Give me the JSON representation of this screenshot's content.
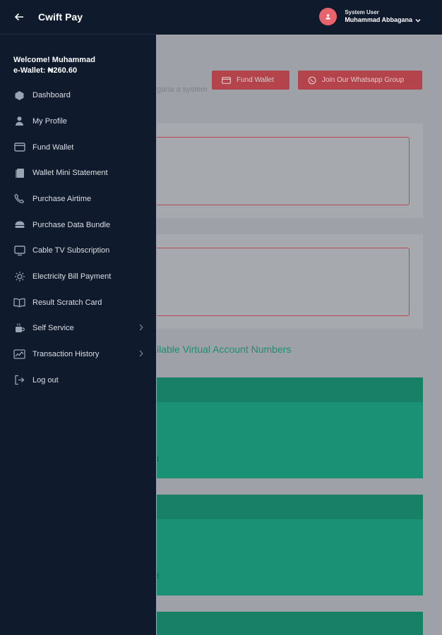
{
  "app": {
    "brand": "Cwift Pay"
  },
  "header": {
    "user_role": "System User",
    "user_name": "Muhammad Abbagana"
  },
  "sidebar": {
    "welcome": "Welcome! Muhammad",
    "wallet": "e-Wallet: ₦260.60",
    "items": [
      {
        "label": "Dashboard",
        "icon": "dashboard-icon"
      },
      {
        "label": "My Profile",
        "icon": "profile-icon"
      },
      {
        "label": "Fund Wallet",
        "icon": "wallet-icon"
      },
      {
        "label": "Wallet Mini Statement",
        "icon": "statement-icon"
      },
      {
        "label": "Purchase Airtime",
        "icon": "phone-icon"
      },
      {
        "label": "Purchase Data Bundle",
        "icon": "data-icon"
      },
      {
        "label": "Cable TV Subscription",
        "icon": "tv-icon"
      },
      {
        "label": "Electricity Bill Payment",
        "icon": "electricity-icon"
      },
      {
        "label": "Result Scratch Card",
        "icon": "book-icon"
      },
      {
        "label": "Self Service",
        "icon": "self-service-icon",
        "has_submenu": true
      },
      {
        "label": "Transaction History",
        "icon": "history-icon",
        "has_submenu": true
      },
      {
        "label": "Log out",
        "icon": "logout-icon"
      }
    ]
  },
  "main": {
    "fund_wallet_label": "Fund Wallet",
    "whatsapp_label": "Join Our Whatsapp Group",
    "subtext": "gana a system",
    "virtual_accounts_title": "ilable Virtual Account Numbers",
    "green_card_text": "t"
  },
  "colors": {
    "sidebar_bg": "#0f1a2c",
    "accent_red": "#b4444c",
    "green": "#1a9174"
  }
}
